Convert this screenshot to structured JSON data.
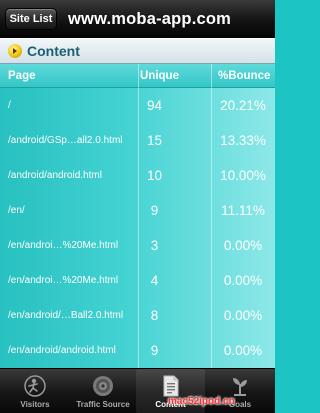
{
  "navbar": {
    "site_list_label": "Site List",
    "title": "www.moba-app.com"
  },
  "section": {
    "title": "Content",
    "icon": "arrow-right-icon"
  },
  "table": {
    "columns": [
      "Page",
      "Unique",
      "%Bounce"
    ],
    "rows": [
      {
        "page": "/",
        "unique": "94",
        "bounce": "20.21%"
      },
      {
        "page": "/android/GSp…all2.0.html",
        "unique": "15",
        "bounce": "13.33%"
      },
      {
        "page": "/android/android.html",
        "unique": "10",
        "bounce": "10.00%"
      },
      {
        "page": "/en/",
        "unique": "9",
        "bounce": "11.11%"
      },
      {
        "page": "/en/androi…%20Me.html",
        "unique": "3",
        "bounce": "0.00%"
      },
      {
        "page": "/en/androi…%20Me.html",
        "unique": "4",
        "bounce": "0.00%"
      },
      {
        "page": "/en/android/…Ball2.0.html",
        "unique": "8",
        "bounce": "0.00%"
      },
      {
        "page": "/en/android/android.html",
        "unique": "9",
        "bounce": "0.00%"
      }
    ]
  },
  "tabbar": {
    "tabs": [
      {
        "label": "Visitors",
        "icon": "visitors-icon",
        "selected": false
      },
      {
        "label": "Traffic Source",
        "icon": "traffic-source-icon",
        "selected": false
      },
      {
        "label": "Content",
        "icon": "content-document-icon",
        "selected": true
      },
      {
        "label": "Goals",
        "icon": "goals-icon",
        "selected": false
      }
    ]
  },
  "watermark": "mac52ipod.cn",
  "colors": {
    "accent": "#1cc4c4",
    "header_text": "#1a5f74",
    "watermark": "#ff3030"
  }
}
